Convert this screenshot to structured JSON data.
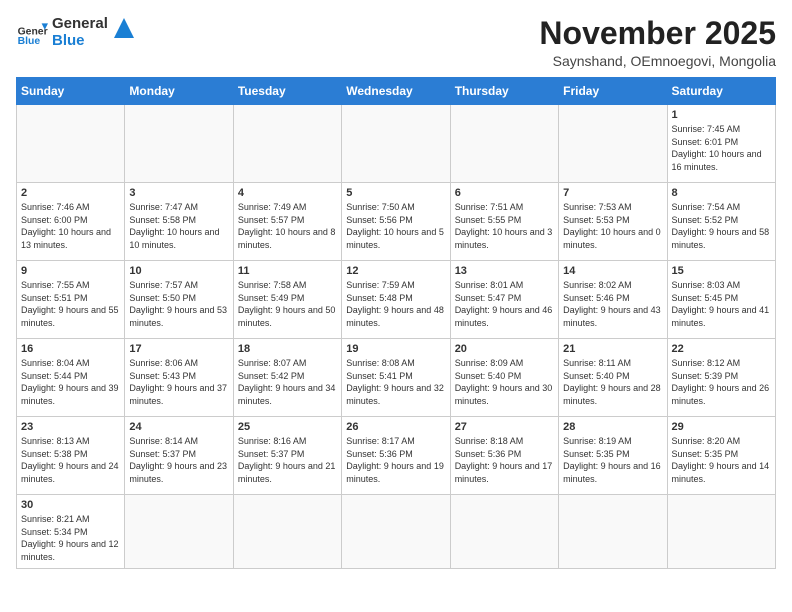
{
  "header": {
    "logo_general": "General",
    "logo_blue": "Blue",
    "month_title": "November 2025",
    "location": "Saynshand, OEmnoegovi, Mongolia"
  },
  "days_of_week": [
    "Sunday",
    "Monday",
    "Tuesday",
    "Wednesday",
    "Thursday",
    "Friday",
    "Saturday"
  ],
  "weeks": [
    [
      {
        "day": "",
        "content": ""
      },
      {
        "day": "",
        "content": ""
      },
      {
        "day": "",
        "content": ""
      },
      {
        "day": "",
        "content": ""
      },
      {
        "day": "",
        "content": ""
      },
      {
        "day": "",
        "content": ""
      },
      {
        "day": "1",
        "content": "Sunrise: 7:45 AM\nSunset: 6:01 PM\nDaylight: 10 hours and 16 minutes."
      }
    ],
    [
      {
        "day": "2",
        "content": "Sunrise: 7:46 AM\nSunset: 6:00 PM\nDaylight: 10 hours and 13 minutes."
      },
      {
        "day": "3",
        "content": "Sunrise: 7:47 AM\nSunset: 5:58 PM\nDaylight: 10 hours and 10 minutes."
      },
      {
        "day": "4",
        "content": "Sunrise: 7:49 AM\nSunset: 5:57 PM\nDaylight: 10 hours and 8 minutes."
      },
      {
        "day": "5",
        "content": "Sunrise: 7:50 AM\nSunset: 5:56 PM\nDaylight: 10 hours and 5 minutes."
      },
      {
        "day": "6",
        "content": "Sunrise: 7:51 AM\nSunset: 5:55 PM\nDaylight: 10 hours and 3 minutes."
      },
      {
        "day": "7",
        "content": "Sunrise: 7:53 AM\nSunset: 5:53 PM\nDaylight: 10 hours and 0 minutes."
      },
      {
        "day": "8",
        "content": "Sunrise: 7:54 AM\nSunset: 5:52 PM\nDaylight: 9 hours and 58 minutes."
      }
    ],
    [
      {
        "day": "9",
        "content": "Sunrise: 7:55 AM\nSunset: 5:51 PM\nDaylight: 9 hours and 55 minutes."
      },
      {
        "day": "10",
        "content": "Sunrise: 7:57 AM\nSunset: 5:50 PM\nDaylight: 9 hours and 53 minutes."
      },
      {
        "day": "11",
        "content": "Sunrise: 7:58 AM\nSunset: 5:49 PM\nDaylight: 9 hours and 50 minutes."
      },
      {
        "day": "12",
        "content": "Sunrise: 7:59 AM\nSunset: 5:48 PM\nDaylight: 9 hours and 48 minutes."
      },
      {
        "day": "13",
        "content": "Sunrise: 8:01 AM\nSunset: 5:47 PM\nDaylight: 9 hours and 46 minutes."
      },
      {
        "day": "14",
        "content": "Sunrise: 8:02 AM\nSunset: 5:46 PM\nDaylight: 9 hours and 43 minutes."
      },
      {
        "day": "15",
        "content": "Sunrise: 8:03 AM\nSunset: 5:45 PM\nDaylight: 9 hours and 41 minutes."
      }
    ],
    [
      {
        "day": "16",
        "content": "Sunrise: 8:04 AM\nSunset: 5:44 PM\nDaylight: 9 hours and 39 minutes."
      },
      {
        "day": "17",
        "content": "Sunrise: 8:06 AM\nSunset: 5:43 PM\nDaylight: 9 hours and 37 minutes."
      },
      {
        "day": "18",
        "content": "Sunrise: 8:07 AM\nSunset: 5:42 PM\nDaylight: 9 hours and 34 minutes."
      },
      {
        "day": "19",
        "content": "Sunrise: 8:08 AM\nSunset: 5:41 PM\nDaylight: 9 hours and 32 minutes."
      },
      {
        "day": "20",
        "content": "Sunrise: 8:09 AM\nSunset: 5:40 PM\nDaylight: 9 hours and 30 minutes."
      },
      {
        "day": "21",
        "content": "Sunrise: 8:11 AM\nSunset: 5:40 PM\nDaylight: 9 hours and 28 minutes."
      },
      {
        "day": "22",
        "content": "Sunrise: 8:12 AM\nSunset: 5:39 PM\nDaylight: 9 hours and 26 minutes."
      }
    ],
    [
      {
        "day": "23",
        "content": "Sunrise: 8:13 AM\nSunset: 5:38 PM\nDaylight: 9 hours and 24 minutes."
      },
      {
        "day": "24",
        "content": "Sunrise: 8:14 AM\nSunset: 5:37 PM\nDaylight: 9 hours and 23 minutes."
      },
      {
        "day": "25",
        "content": "Sunrise: 8:16 AM\nSunset: 5:37 PM\nDaylight: 9 hours and 21 minutes."
      },
      {
        "day": "26",
        "content": "Sunrise: 8:17 AM\nSunset: 5:36 PM\nDaylight: 9 hours and 19 minutes."
      },
      {
        "day": "27",
        "content": "Sunrise: 8:18 AM\nSunset: 5:36 PM\nDaylight: 9 hours and 17 minutes."
      },
      {
        "day": "28",
        "content": "Sunrise: 8:19 AM\nSunset: 5:35 PM\nDaylight: 9 hours and 16 minutes."
      },
      {
        "day": "29",
        "content": "Sunrise: 8:20 AM\nSunset: 5:35 PM\nDaylight: 9 hours and 14 minutes."
      }
    ],
    [
      {
        "day": "30",
        "content": "Sunrise: 8:21 AM\nSunset: 5:34 PM\nDaylight: 9 hours and 12 minutes."
      },
      {
        "day": "",
        "content": ""
      },
      {
        "day": "",
        "content": ""
      },
      {
        "day": "",
        "content": ""
      },
      {
        "day": "",
        "content": ""
      },
      {
        "day": "",
        "content": ""
      },
      {
        "day": "",
        "content": ""
      }
    ]
  ]
}
